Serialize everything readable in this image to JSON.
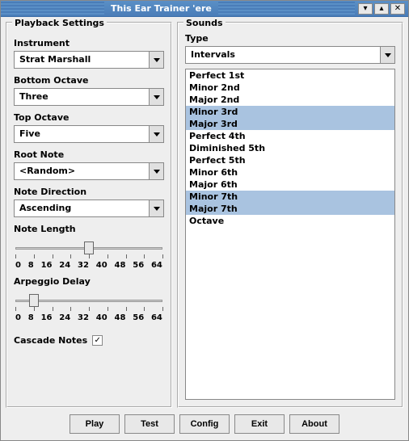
{
  "window": {
    "title": "This Ear Trainer 'ere"
  },
  "playback": {
    "title": "Playback Settings",
    "instrument_label": "Instrument",
    "instrument_value": "Strat Marshall",
    "bottom_octave_label": "Bottom Octave",
    "bottom_octave_value": "Three",
    "top_octave_label": "Top Octave",
    "top_octave_value": "Five",
    "root_note_label": "Root Note",
    "root_note_value": "<Random>",
    "note_direction_label": "Note Direction",
    "note_direction_value": "Ascending",
    "note_length_label": "Note Length",
    "note_length_value": 32,
    "note_length_min": 0,
    "note_length_max": 64,
    "arpeggio_delay_label": "Arpeggio Delay",
    "arpeggio_delay_value": 8,
    "arpeggio_delay_min": 0,
    "arpeggio_delay_max": 64,
    "slider_ticks": [
      "0",
      "8",
      "16",
      "24",
      "32",
      "40",
      "48",
      "56",
      "64"
    ],
    "cascade_label": "Cascade Notes",
    "cascade_checked": true
  },
  "sounds": {
    "title": "Sounds",
    "type_label": "Type",
    "type_value": "Intervals",
    "items": [
      {
        "label": "Perfect 1st",
        "selected": false
      },
      {
        "label": "Minor 2nd",
        "selected": false
      },
      {
        "label": "Major 2nd",
        "selected": false
      },
      {
        "label": "Minor 3rd",
        "selected": true
      },
      {
        "label": "Major 3rd",
        "selected": true
      },
      {
        "label": "Perfect 4th",
        "selected": false
      },
      {
        "label": "Diminished 5th",
        "selected": false
      },
      {
        "label": "Perfect 5th",
        "selected": false
      },
      {
        "label": "Minor 6th",
        "selected": false
      },
      {
        "label": "Major 6th",
        "selected": false
      },
      {
        "label": "Minor 7th",
        "selected": true
      },
      {
        "label": "Major 7th",
        "selected": true
      },
      {
        "label": "Octave",
        "selected": false
      }
    ]
  },
  "buttons": {
    "play": "Play",
    "test": "Test",
    "config": "Config",
    "exit": "Exit",
    "about": "About"
  }
}
